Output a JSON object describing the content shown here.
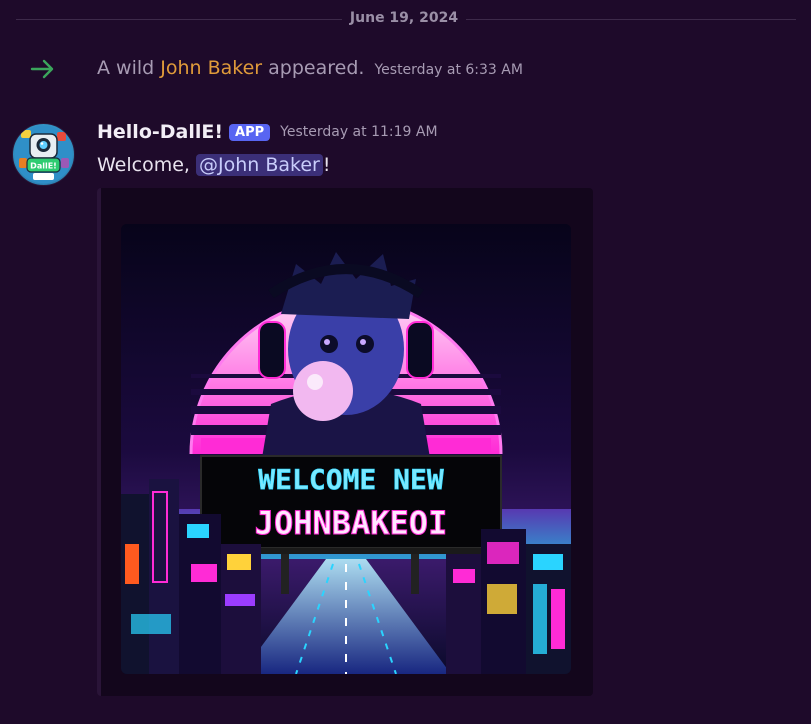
{
  "divider": {
    "date": "June 19, 2024"
  },
  "join": {
    "prefix": "A wild ",
    "user": "John Baker",
    "suffix": " appeared.",
    "timestamp": "Yesterday at 6:33 AM",
    "icon": "arrow-right-icon",
    "icon_color": "#3ba55c"
  },
  "message": {
    "author": "Hello-DallE!",
    "badge": "APP",
    "timestamp": "Yesterday at 11:19 AM",
    "text_prefix": "Welcome, ",
    "mention": "@John Baker",
    "text_suffix": "!",
    "avatar_badge": "DallE!"
  },
  "embed": {
    "image": {
      "headline_line1": "WELCOME NEW",
      "headline_line2": "JOHNBAKEOI",
      "accent_colors": [
        "#ff2bd6",
        "#2ad4ff",
        "#9b3cff"
      ]
    }
  },
  "colors": {
    "background": "#1e0a2a",
    "badge": "#5865f2",
    "join_name": "#e09b3a",
    "mention_bg": "#3b2f78"
  }
}
